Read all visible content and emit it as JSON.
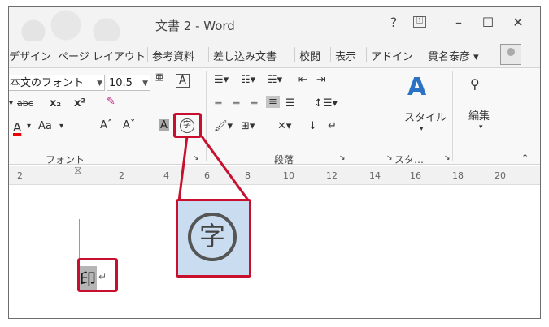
{
  "window": {
    "title": "文書 2 - Word",
    "help": "?",
    "restore_ribbon": "⍐",
    "minimize": "–",
    "maximize": "☐",
    "close": "✕"
  },
  "tabs": [
    "デザイン",
    "ページ レイアウト",
    "参考資料",
    "差し込み文書",
    "校閲",
    "表示",
    "アドイン"
  ],
  "user_name": "貫名泰彦 ▾",
  "font": {
    "name": "本文のフォント",
    "size": "10.5",
    "phonetic_label": "亜",
    "box_char": "A",
    "strike": "abc",
    "sub": "x₂",
    "sup": "x²",
    "font_color": "A",
    "change_case": "Aa",
    "grow": "Aˆ",
    "shrink": "Aˇ",
    "char_shade": "A",
    "enclose_char": "字",
    "group_label": "フォント"
  },
  "paragraph": {
    "group_label": "段落"
  },
  "styles": {
    "label": "スタイル",
    "group_label": "スタ…"
  },
  "editing": {
    "label": "編集"
  },
  "ruler": {
    "ticks": [
      "2",
      "2",
      "4",
      "6",
      "8",
      "10",
      "12",
      "14",
      "16",
      "18",
      "20"
    ]
  },
  "document": {
    "selected_char": "印",
    "para_mark": "↵"
  },
  "zoom": {
    "char": "字"
  }
}
